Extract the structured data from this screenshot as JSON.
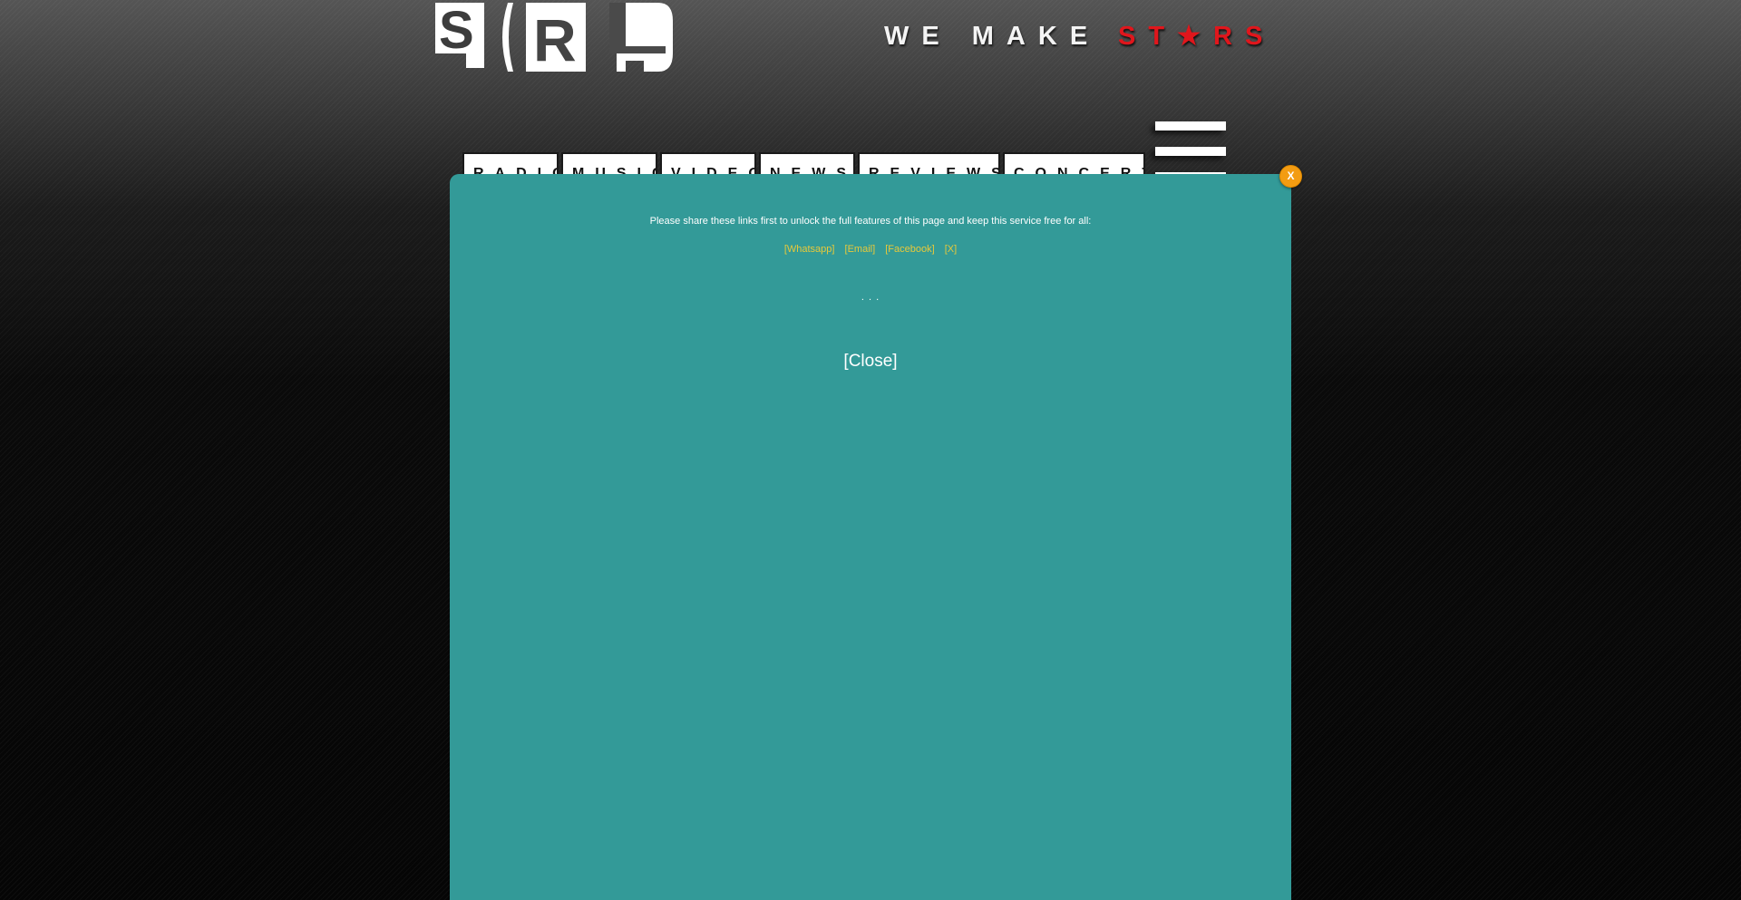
{
  "header": {
    "logo_icon": "srl-logo-icon",
    "slogan_white": "WE MAKE",
    "slogan_red": "ST★RS"
  },
  "nav": {
    "tabs": [
      {
        "label": "RADIO"
      },
      {
        "label": "MUSIC"
      },
      {
        "label": "VIDEOS"
      },
      {
        "label": "NEWS"
      },
      {
        "label": "REVIEWS"
      },
      {
        "label": "CONCERTS"
      }
    ],
    "menu_icon": "hamburger-menu-icon"
  },
  "overlay": {
    "message": "Please share these links first to unlock the full features of this page and keep this service free for all:",
    "links": [
      "[Whatsapp]",
      "[Email]",
      "[Facebook]",
      "[X]"
    ],
    "ellipsis": ". . .",
    "close_label": "[Close]",
    "x_label": "X"
  },
  "colors": {
    "overlay_bg": "#339a98",
    "link": "#e8c93a",
    "slogan_red": "#e0161c",
    "x_button": "#f39c12"
  }
}
